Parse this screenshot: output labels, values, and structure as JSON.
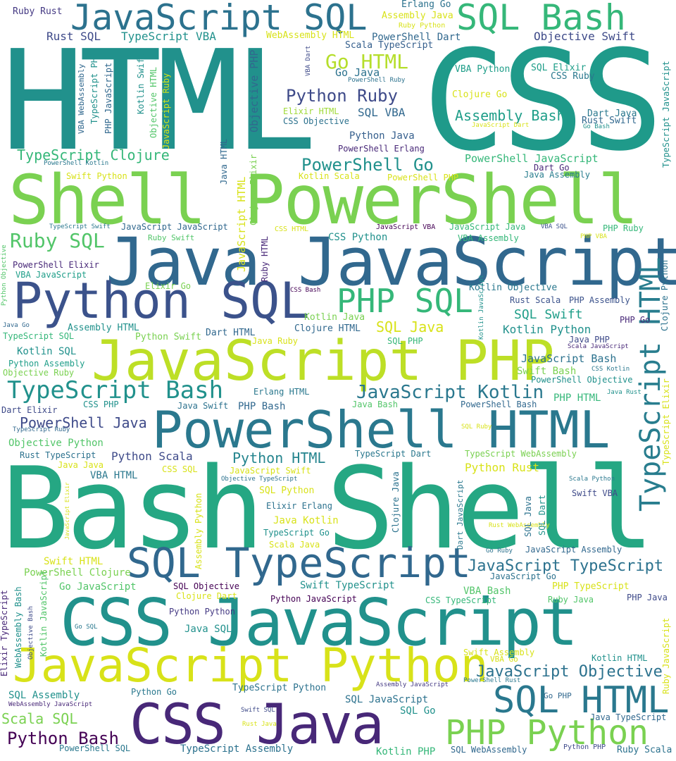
{
  "words": [
    {
      "text": "HTML",
      "color": "#21918c"
    },
    {
      "text": "CSS",
      "color": "#1f9a8a"
    },
    {
      "text": "Bash Shell",
      "color": "#25a783"
    },
    {
      "text": "Shell PowerShell",
      "color": "#7ad151"
    },
    {
      "text": "Java JavaScript",
      "color": "#31688e"
    },
    {
      "text": "CSS JavaScript",
      "color": "#21918c"
    },
    {
      "text": "JavaScript PHP",
      "color": "#bddf26"
    },
    {
      "text": "JavaScript Python",
      "color": "#d8e219"
    },
    {
      "text": "Python SQL",
      "color": "#3b528b"
    },
    {
      "text": "PowerShell HTML",
      "color": "#2a788e"
    },
    {
      "text": "CSS Java",
      "color": "#482878"
    },
    {
      "text": "SQL TypeScript",
      "color": "#31688e"
    },
    {
      "text": "JavaScript SQL",
      "color": "#2c728e"
    },
    {
      "text": "SQL Bash",
      "color": "#35b779"
    },
    {
      "text": "SQL HTML",
      "color": "#2a788e"
    },
    {
      "text": "PHP Python",
      "color": "#7ad151"
    },
    {
      "text": "TypeScript HTML",
      "color": "#287d8e"
    },
    {
      "text": "PHP SQL",
      "color": "#35b779"
    },
    {
      "text": "TypeScript Bash",
      "color": "#21918c"
    },
    {
      "text": "Ruby SQL",
      "color": "#52c569"
    },
    {
      "text": "Python Ruby",
      "color": "#3e4a89"
    },
    {
      "text": "Go HTML",
      "color": "#b5de2b"
    },
    {
      "text": "JavaScript Kotlin",
      "color": "#2a788e"
    },
    {
      "text": "PowerShell Go",
      "color": "#21918c"
    },
    {
      "text": "Python Bash",
      "color": "#440154"
    },
    {
      "text": "JavaScript TypeScript",
      "color": "#2c728e"
    },
    {
      "text": "JavaScript Objective",
      "color": "#2c728e"
    },
    {
      "text": "Python HTML",
      "color": "#25858e"
    },
    {
      "text": "TypeScript Clojure",
      "color": "#d8e219"
    },
    {
      "text": "PowerShell Java",
      "color": "#35b779"
    },
    {
      "text": "Assembly Bash",
      "color": "#3e4a89"
    },
    {
      "text": "Scala SQL",
      "color": "#1f9e89"
    },
    {
      "text": "JavaScript Ruby",
      "color": "#7ad151"
    },
    {
      "text": "Objective PHP",
      "color": "#31688e"
    },
    {
      "text": "Ruby Rust",
      "color": "#443983"
    },
    {
      "text": "Erlang Go",
      "color": "#2c728e"
    },
    {
      "text": "Assembly Java",
      "color": "#d8e219"
    },
    {
      "text": "Rust SQL",
      "color": "#3e4a89"
    },
    {
      "text": "TypeScript VBA",
      "color": "#21918c"
    },
    {
      "text": "WebAssembly HTML",
      "color": "#d8e219"
    },
    {
      "text": "PowerShell Dart",
      "color": "#31688e"
    },
    {
      "text": "Objective Swift",
      "color": "#3e4a89"
    },
    {
      "text": "Scala TypeScript",
      "color": "#355f8d"
    },
    {
      "text": "Ruby Python",
      "color": "#d8e219"
    },
    {
      "text": "Go Java",
      "color": "#2c728e"
    },
    {
      "text": "PowerShell Ruby",
      "color": "#2c728e"
    },
    {
      "text": "VBA Python",
      "color": "#1f9e89"
    },
    {
      "text": "SQL Elixir",
      "color": "#1f9e89"
    },
    {
      "text": "CSS Ruby",
      "color": "#2a788e"
    },
    {
      "text": "Clojure Go",
      "color": "#d8e219"
    },
    {
      "text": "SQL VBA",
      "color": "#31688e"
    },
    {
      "text": "Elixir HTML",
      "color": "#a0da39"
    },
    {
      "text": "CSS Objective",
      "color": "#2c728e"
    },
    {
      "text": "Dart Java",
      "color": "#2a788e"
    },
    {
      "text": "Rust Swift",
      "color": "#31688e"
    },
    {
      "text": "Go Bash",
      "color": "#21918c"
    },
    {
      "text": "JavaScript Dart",
      "color": "#d8e219"
    },
    {
      "text": "Python Java",
      "color": "#355f8d"
    },
    {
      "text": "PowerShell Erlang",
      "color": "#482878"
    },
    {
      "text": "PowerShell JavaScript",
      "color": "#35b779"
    },
    {
      "text": "Dart Go",
      "color": "#482878"
    },
    {
      "text": "Java Assembly",
      "color": "#287d8e"
    },
    {
      "text": "Kotlin Scala",
      "color": "#d8e219"
    },
    {
      "text": "PowerShell PHP",
      "color": "#d8e219"
    },
    {
      "text": "PowerShell Kotlin",
      "color": "#2a788e"
    },
    {
      "text": "Swift Python",
      "color": "#d8e219"
    },
    {
      "text": "TypeScript Swift",
      "color": "#2a788e"
    },
    {
      "text": "JavaScript JavaScript",
      "color": "#31688e"
    },
    {
      "text": "CSS HTML",
      "color": "#d8e219"
    },
    {
      "text": "CSS Python",
      "color": "#21918c"
    },
    {
      "text": "JavaScript VBA",
      "color": "#440154"
    },
    {
      "text": "JavaScript Java",
      "color": "#35b779"
    },
    {
      "text": "VBA SQL",
      "color": "#3b528b"
    },
    {
      "text": "PHP Ruby",
      "color": "#35b779"
    },
    {
      "text": "PHP VBA",
      "color": "#d8e219"
    },
    {
      "text": "VBA Assembly",
      "color": "#35b779"
    },
    {
      "text": "Ruby Swift",
      "color": "#52c569"
    },
    {
      "text": "PowerShell Elixir",
      "color": "#482878"
    },
    {
      "text": "VBA JavaScript",
      "color": "#1f9e89"
    },
    {
      "text": "Elixir Go",
      "color": "#7ad151"
    },
    {
      "text": "CSS Bash",
      "color": "#440154"
    },
    {
      "text": "Kotlin Objective",
      "color": "#2a788e"
    },
    {
      "text": "Rust Scala",
      "color": "#3b528b"
    },
    {
      "text": "PHP Assembly",
      "color": "#3b528b"
    },
    {
      "text": "SQL Swift",
      "color": "#1f9e89"
    },
    {
      "text": "Kotlin Java",
      "color": "#7ad151"
    },
    {
      "text": "Clojure HTML",
      "color": "#31688e"
    },
    {
      "text": "SQL Java",
      "color": "#d8e219"
    },
    {
      "text": "PHP Go",
      "color": "#482878"
    },
    {
      "text": "Kotlin Python",
      "color": "#21918c"
    },
    {
      "text": "Java Go",
      "color": "#31688e"
    },
    {
      "text": "Assembly HTML",
      "color": "#21918c"
    },
    {
      "text": "TypeScript SQL",
      "color": "#35b779"
    },
    {
      "text": "Python Swift",
      "color": "#7ad151"
    },
    {
      "text": "Dart HTML",
      "color": "#31688e"
    },
    {
      "text": "Java Ruby",
      "color": "#d8e219"
    },
    {
      "text": "SQL PHP",
      "color": "#35b779"
    },
    {
      "text": "Java PHP",
      "color": "#3e4a89"
    },
    {
      "text": "Scala JavaScript",
      "color": "#482878"
    },
    {
      "text": "Kotlin SQL",
      "color": "#21918c"
    },
    {
      "text": "Python Assembly",
      "color": "#1f9e89"
    },
    {
      "text": "Objective Ruby",
      "color": "#7ad151"
    },
    {
      "text": "JavaScript Bash",
      "color": "#2c728e"
    },
    {
      "text": "Swift Bash",
      "color": "#7ad151"
    },
    {
      "text": "CSS Kotlin",
      "color": "#2a788e"
    },
    {
      "text": "PowerShell Objective",
      "color": "#21918c"
    },
    {
      "text": "Erlang HTML",
      "color": "#2a788e"
    },
    {
      "text": "PHP HTML",
      "color": "#35b779"
    },
    {
      "text": "Java Rust",
      "color": "#21918c"
    },
    {
      "text": "Dart Elixir",
      "color": "#3e4a89"
    },
    {
      "text": "CSS PHP",
      "color": "#21918c"
    },
    {
      "text": "Java Swift",
      "color": "#2c728e"
    },
    {
      "text": "PHP Bash",
      "color": "#31688e"
    },
    {
      "text": "Java Bash",
      "color": "#52c569"
    },
    {
      "text": "PowerShell Bash",
      "color": "#31688e"
    },
    {
      "text": "TypeScript Ruby",
      "color": "#31688e"
    },
    {
      "text": "SQL Ruby",
      "color": "#d8e219"
    },
    {
      "text": "Objective Python",
      "color": "#52c569"
    },
    {
      "text": "Rust TypeScript",
      "color": "#2c728e"
    },
    {
      "text": "Python Scala",
      "color": "#3e4a89"
    },
    {
      "text": "TypeScript Dart",
      "color": "#2a788e"
    },
    {
      "text": "TypeScript WebAssembly",
      "color": "#7ad151"
    },
    {
      "text": "Java Java",
      "color": "#d8e219"
    },
    {
      "text": "CSS SQL",
      "color": "#d8e219"
    },
    {
      "text": "JavaScript Swift",
      "color": "#d8e219"
    },
    {
      "text": "Python Rust",
      "color": "#d8e219"
    },
    {
      "text": "VBA HTML",
      "color": "#2a788e"
    },
    {
      "text": "Objective TypeScript",
      "color": "#2c728e"
    },
    {
      "text": "Scala Python",
      "color": "#2a788e"
    },
    {
      "text": "SQL Python",
      "color": "#d8e219"
    },
    {
      "text": "Swift VBA",
      "color": "#3e4a89"
    },
    {
      "text": "Elixir Erlang",
      "color": "#2c728e"
    },
    {
      "text": "Java Kotlin",
      "color": "#d8e219"
    },
    {
      "text": "TypeScript Go",
      "color": "#21918c"
    },
    {
      "text": "Scala Java",
      "color": "#d8e219"
    },
    {
      "text": "Rust WebAssembly",
      "color": "#d8e219"
    },
    {
      "text": "Go Ruby",
      "color": "#2c728e"
    },
    {
      "text": "JavaScript Assembly",
      "color": "#31688e"
    },
    {
      "text": "Swift HTML",
      "color": "#d8e219"
    },
    {
      "text": "PowerShell Clojure",
      "color": "#7ad151"
    },
    {
      "text": "JavaScript Go",
      "color": "#2c728e"
    },
    {
      "text": "Go JavaScript",
      "color": "#52c569"
    },
    {
      "text": "SQL Objective",
      "color": "#440154"
    },
    {
      "text": "Swift TypeScript",
      "color": "#21918c"
    },
    {
      "text": "VBA Bash",
      "color": "#52c569"
    },
    {
      "text": "PHP TypeScript",
      "color": "#d8e219"
    },
    {
      "text": "Clojure Dart",
      "color": "#d8e219"
    },
    {
      "text": "Python JavaScript",
      "color": "#440154"
    },
    {
      "text": "CSS TypeScript",
      "color": "#35b779"
    },
    {
      "text": "Ruby Java",
      "color": "#52c569"
    },
    {
      "text": "PHP Java",
      "color": "#3e4a89"
    },
    {
      "text": "Python Python",
      "color": "#443983"
    },
    {
      "text": "Java SQL",
      "color": "#21918c"
    },
    {
      "text": "Go SQL",
      "color": "#2a788e"
    },
    {
      "text": "Swift Assembly",
      "color": "#d8e219"
    },
    {
      "text": "VBA Go",
      "color": "#d8e219"
    },
    {
      "text": "Kotlin HTML",
      "color": "#21918c"
    },
    {
      "text": "TypeScript Python",
      "color": "#2c728e"
    },
    {
      "text": "Assembly JavaScript",
      "color": "#443983"
    },
    {
      "text": "PowerShell Rust",
      "color": "#2a788e"
    },
    {
      "text": "SQL Assembly",
      "color": "#21918c"
    },
    {
      "text": "WebAssembly JavaScript",
      "color": "#482878"
    },
    {
      "text": "Python Go",
      "color": "#2a788e"
    },
    {
      "text": "SQL JavaScript",
      "color": "#2c728e"
    },
    {
      "text": "Go PHP",
      "color": "#31688e"
    },
    {
      "text": "SQL Go",
      "color": "#21918c"
    },
    {
      "text": "Java TypeScript",
      "color": "#31688e"
    },
    {
      "text": "Swift SQL",
      "color": "#3e4a89"
    },
    {
      "text": "Rust Java",
      "color": "#d8e219"
    },
    {
      "text": "PowerShell SQL",
      "color": "#2a788e"
    },
    {
      "text": "TypeScript Assembly",
      "color": "#2c728e"
    },
    {
      "text": "Kotlin PHP",
      "color": "#35b779"
    },
    {
      "text": "SQL WebAssembly",
      "color": "#31688e"
    },
    {
      "text": "Python PHP",
      "color": "#3e4a89"
    },
    {
      "text": "Ruby Scala",
      "color": "#2c728e"
    },
    {
      "text": "VBA WebAssembly",
      "color": "#31688e"
    },
    {
      "text": "TypeScript PHP",
      "color": "#21918c"
    },
    {
      "text": "PHP JavaScript",
      "color": "#31688e"
    },
    {
      "text": "Kotlin Swift",
      "color": "#21918c"
    },
    {
      "text": "Objective HTML",
      "color": "#52c569"
    },
    {
      "text": "VBA Dart",
      "color": "#3e4a89"
    },
    {
      "text": "Java HTML",
      "color": "#31688e"
    },
    {
      "text": "JavaScript HTML",
      "color": "#d8e219"
    },
    {
      "text": "Clojure Elixir",
      "color": "#7ad151"
    },
    {
      "text": "Ruby HTML",
      "color": "#482878"
    },
    {
      "text": "Python Objective",
      "color": "#52c569"
    },
    {
      "text": "Kotlin JavaScript",
      "color": "#21918c"
    },
    {
      "text": "Clojure Java",
      "color": "#2c728e"
    },
    {
      "text": "SQL Dart",
      "color": "#21918c"
    },
    {
      "text": "SQL Java",
      "color": "#2c728e"
    },
    {
      "text": "Dart JavaScript",
      "color": "#2a788e"
    },
    {
      "text": "Assembly Python",
      "color": "#d8e219"
    },
    {
      "text": "JavaScript Elixir",
      "color": "#d8e219"
    },
    {
      "text": "TypeScript Elixir",
      "color": "#d8e219"
    },
    {
      "text": "TypeScript JavaScript",
      "color": "#21918c"
    },
    {
      "text": "Clojure Python",
      "color": "#2c728e"
    },
    {
      "text": "Elixir TypeScript",
      "color": "#31688e"
    },
    {
      "text": "WebAssembly Bash",
      "color": "#482878"
    },
    {
      "text": "Objective Bash",
      "color": "#21918c"
    },
    {
      "text": "Kotlin JavaScript",
      "color": "#3e4a89"
    },
    {
      "text": "Ruby JavaScript",
      "color": "#52c569"
    },
    {
      "text": "Swift JavaScript",
      "color": "#d8e219"
    }
  ]
}
